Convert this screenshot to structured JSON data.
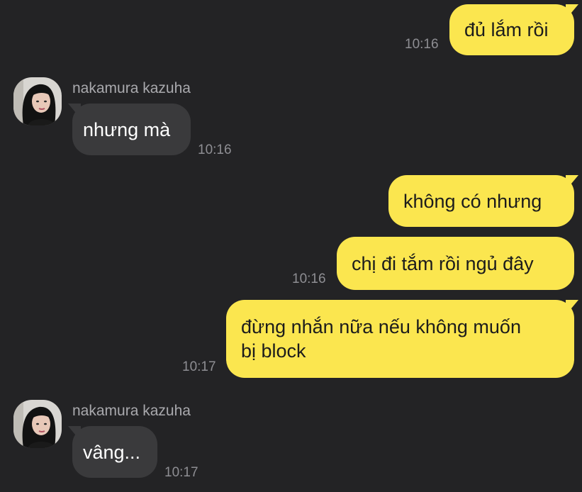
{
  "contact": {
    "name": "nakamura kazuha"
  },
  "messages": [
    {
      "text": "đủ lắm rồi",
      "time": "10:16"
    },
    {
      "text": "nhưng mà",
      "time": "10:16"
    },
    {
      "text": "không có nhưng"
    },
    {
      "text": "chị đi tắm rồi ngủ đây",
      "time": "10:16"
    },
    {
      "line1": "đừng nhắn nữa nếu không muốn",
      "line2": "bị block",
      "time": "10:17"
    },
    {
      "text": "vâng...",
      "time": "10:17"
    }
  ],
  "colors": {
    "background": "#232325",
    "sent_bubble": "#fbe64f",
    "received_bubble": "#3a3a3c",
    "timestamp": "#8e8e93"
  },
  "icons": {
    "avatar": "contact-avatar-photo"
  }
}
